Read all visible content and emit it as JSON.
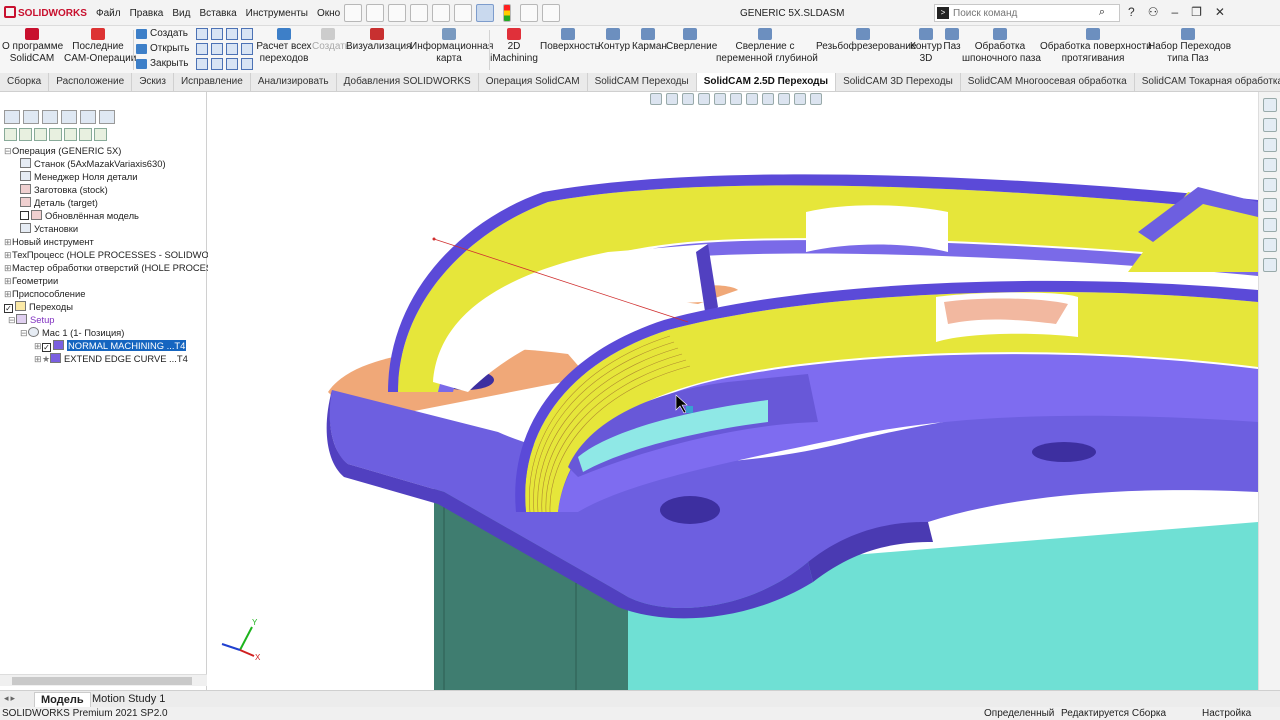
{
  "titlebar": {
    "brand": "SOLIDWORKS",
    "menus": [
      "Файл",
      "Правка",
      "Вид",
      "Вставка",
      "Инструменты",
      "Окно"
    ],
    "document": "GENERIC 5X.SLDASM",
    "search_placeholder": "Поиск команд"
  },
  "ribbon": {
    "about_line1": "О программе",
    "about_line2": "SolidCAM",
    "recent_line1": "Последние",
    "recent_line2": "CAM-Операции",
    "create": "Создать",
    "open": "Открыть",
    "close": "Закрыть",
    "calc_line1": "Расчет всех",
    "calc_line2": "переходов",
    "generate": "Создать",
    "visualize": "Визуализация",
    "info_line1": "Информационная",
    "info_line2": "карта",
    "imachining_line1": "2D",
    "imachining_line2": "iMachining",
    "surface": "Поверхность",
    "contour": "Контур",
    "pocket": "Карман",
    "drill": "Сверление",
    "vardrill_line1": "Сверление с",
    "vardrill_line2": "переменной глубиной",
    "thread": "Резьбофрезерование",
    "contour3d_line1": "Контур",
    "contour3d_line2": "3D",
    "slot": "Паз",
    "keyslot_line1": "Обработка",
    "keyslot_line2": "шпоночного паза",
    "broach_line1": "Обработка поверхности",
    "broach_line2": "протягивания",
    "slotset_line1": "Набор Переходов",
    "slotset_line2": "типа Паз"
  },
  "tabs": [
    "Сборка",
    "Расположение",
    "Эскиз",
    "Исправление",
    "Анализировать",
    "Добавления SOLIDWORKS",
    "Операция SolidCAM",
    "SolidCAM Переходы",
    "SolidCAM 2.5D Переходы",
    "SolidCAM 3D Переходы",
    "SolidCAM Многоосевая обработка",
    "SolidCAM Токарная обработка"
  ],
  "active_tab": "SolidCAM 2.5D Переходы",
  "tree": [
    {
      "label": "Операция (GENERIC 5X)"
    },
    {
      "label": "Станок (5AxMazakVariaxis630)"
    },
    {
      "label": "Менеджер Ноля детали"
    },
    {
      "label": "Заготовка (stock)"
    },
    {
      "label": "Деталь (target)"
    },
    {
      "label": "Обновлённая модель"
    },
    {
      "label": "Установки"
    },
    {
      "label": "Новый инструмент"
    },
    {
      "label": "ТехПроцесс (HOLE PROCESSES - SOLIDWORKS"
    },
    {
      "label": "Мастер обработки отверстий (HOLE PROCESS"
    },
    {
      "label": "Геометрии"
    },
    {
      "label": "Приспособление"
    },
    {
      "label": "Переходы"
    },
    {
      "label": "Setup"
    },
    {
      "label": "Mac 1 (1- Позиция)"
    },
    {
      "label": "NORMAL MACHINING ...T4"
    },
    {
      "label": "EXTEND EDGE CURVE ...T4"
    }
  ],
  "axis": {
    "y": "Y",
    "x": "X"
  },
  "bottom_tabs": {
    "model": "Модель",
    "motion": "Motion Study 1"
  },
  "status": {
    "product": "SOLIDWORKS Premium 2021 SP2.0",
    "defined": "Определенный",
    "editing": "Редактируется Сборка",
    "custom": "Настройка"
  },
  "colors": {
    "part_blue": "#6d5fe0",
    "part_yellow": "#e6e63a",
    "stock_teal": "#6fe0d4",
    "fixture_orange": "#f0a878",
    "selection": "#1565c0",
    "brand_red": "#c8102e"
  }
}
